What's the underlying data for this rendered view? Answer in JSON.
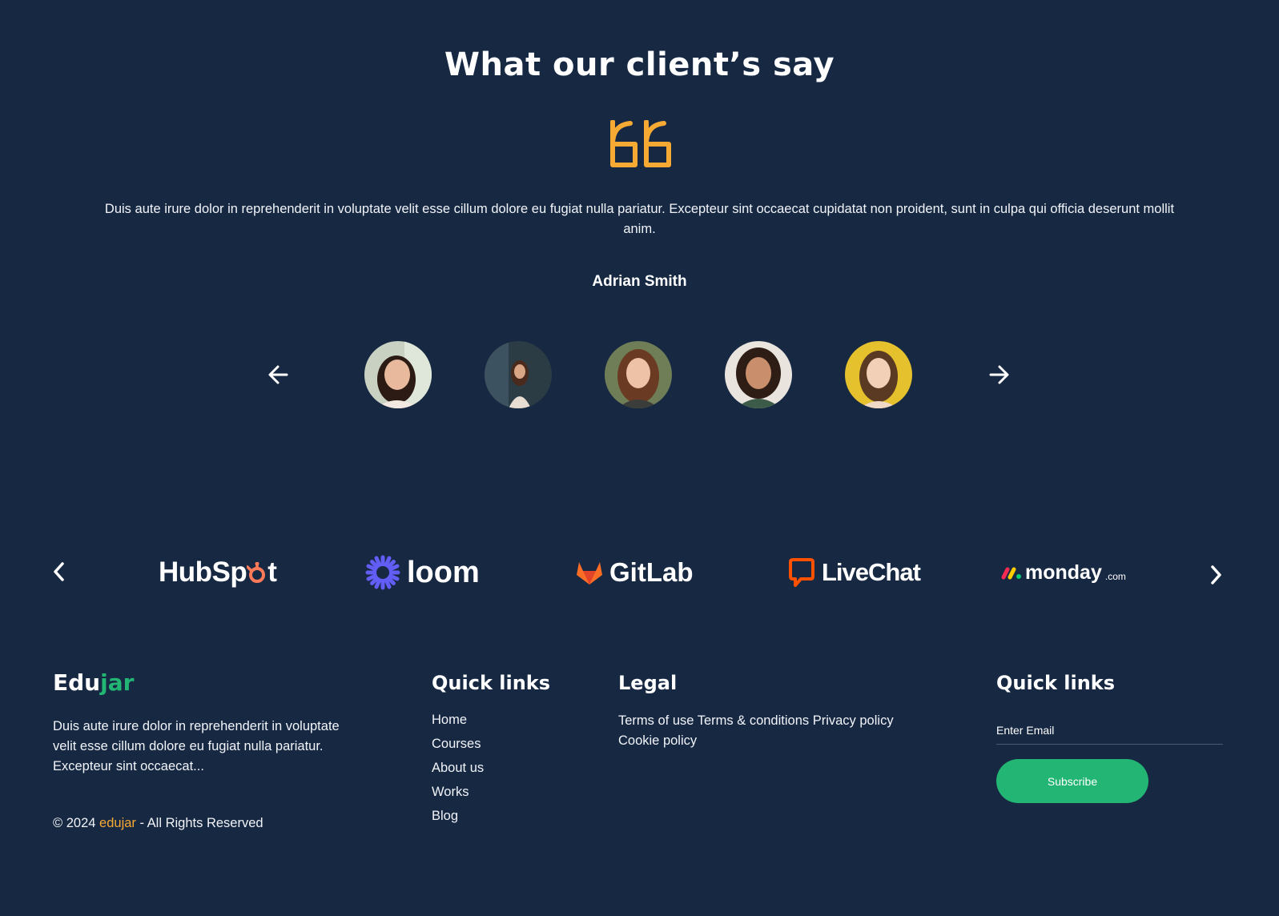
{
  "testimonial": {
    "title": "What our client’s say",
    "quote": "Duis aute irure dolor in reprehenderit in voluptate velit esse cillum dolore eu fugiat nulla pariatur. Excepteur sint occaecat cupidatat non proident, sunt in culpa qui officia deserunt mollit anim.",
    "author": "Adrian Smith",
    "quote_icon": "quote-icon",
    "accent_color": "#f6a933",
    "avatars": [
      "avatar-1",
      "avatar-2",
      "avatar-3",
      "avatar-4",
      "avatar-5"
    ]
  },
  "partners": {
    "logos": [
      {
        "name": "HubSpot",
        "prefix": "HubSp",
        "suffix": "t"
      },
      {
        "name": "loom"
      },
      {
        "name": "GitLab"
      },
      {
        "name": "LiveChat"
      },
      {
        "name": "monday",
        "suffix": ".com"
      }
    ]
  },
  "footer": {
    "brand": {
      "part1": "Edu",
      "part2": "jar"
    },
    "about": "Duis aute irure dolor in reprehenderit in voluptate velit esse cillum dolore eu fugiat nulla pariatur. Excepteur sint occaecat...",
    "copyright": {
      "prefix": "© 2024",
      "brand": "edujar",
      "suffix": " - All Rights Reserved"
    },
    "quick_links": {
      "title": "Quick links",
      "items": [
        "Home",
        "Courses",
        "About us",
        "Works",
        "Blog"
      ]
    },
    "legal": {
      "title": "Legal",
      "text": "Terms of use Terms & conditions Privacy policy Cookie policy"
    },
    "newsletter": {
      "title": "Quick links",
      "placeholder": "Enter Email",
      "button": "Subscribe"
    }
  },
  "colors": {
    "background": "#172843",
    "accent_green": "#22b573",
    "accent_orange": "#f6a933"
  }
}
